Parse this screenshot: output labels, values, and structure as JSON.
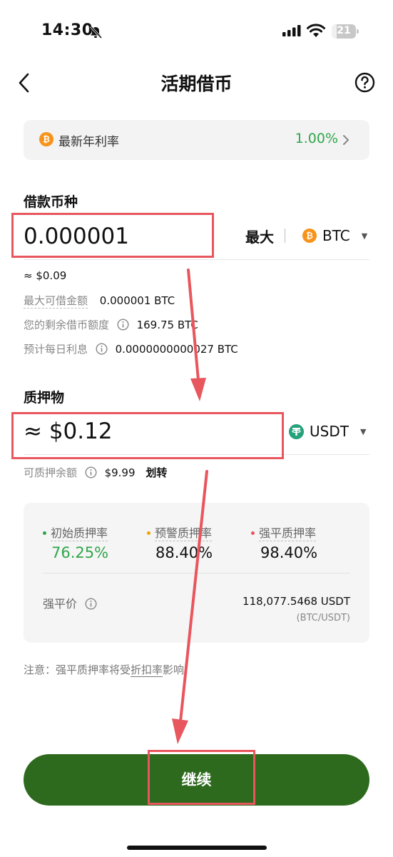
{
  "status_bar": {
    "time": "14:30",
    "battery": "21",
    "battery_level_percent": 21
  },
  "nav": {
    "title": "活期借币"
  },
  "rate_banner": {
    "label": "最新年利率",
    "value": "1.00%",
    "coin_glyph": "₿"
  },
  "borrow": {
    "title": "借款币种",
    "amount": "0.000001",
    "max_label": "最大",
    "coin": "BTC",
    "coin_glyph": "₿",
    "usd_value": "≈ $0.09",
    "rows": [
      {
        "label": "最大可借金额",
        "value": "0.000001 BTC"
      },
      {
        "label": "您的剩余借币额度",
        "value": "169.75 BTC"
      },
      {
        "label": "预计每日利息",
        "value": "0.0000000000027 BTC"
      }
    ]
  },
  "collateral": {
    "title": "质押物",
    "amount": "≈ $0.12",
    "coin": "USDT",
    "available_label": "可质押余额",
    "available_value": "$9.99",
    "transfer_label": "划转"
  },
  "ratios": {
    "items": [
      {
        "label": "初始质押率",
        "value": "76.25%",
        "dot_color": "#2fa64b",
        "value_color": "#2fa64b"
      },
      {
        "label": "预警质押率",
        "value": "88.40%",
        "dot_color": "#f0a500",
        "value_color": "#111111"
      },
      {
        "label": "强平质押率",
        "value": "98.40%",
        "dot_color": "#e8565e",
        "value_color": "#111111"
      }
    ],
    "liquidation_label": "强平价",
    "liquidation_value": "118,077.5468 USDT",
    "liquidation_pair": "(BTC/USDT)"
  },
  "note": {
    "prefix": "注意：强平质押率将受",
    "link": "折扣率",
    "suffix": "影响"
  },
  "continue_label": "继续",
  "colors": {
    "accent_green": "#2fa64b",
    "button_green": "#2d6a1d",
    "annotation_red": "#e8565e"
  }
}
